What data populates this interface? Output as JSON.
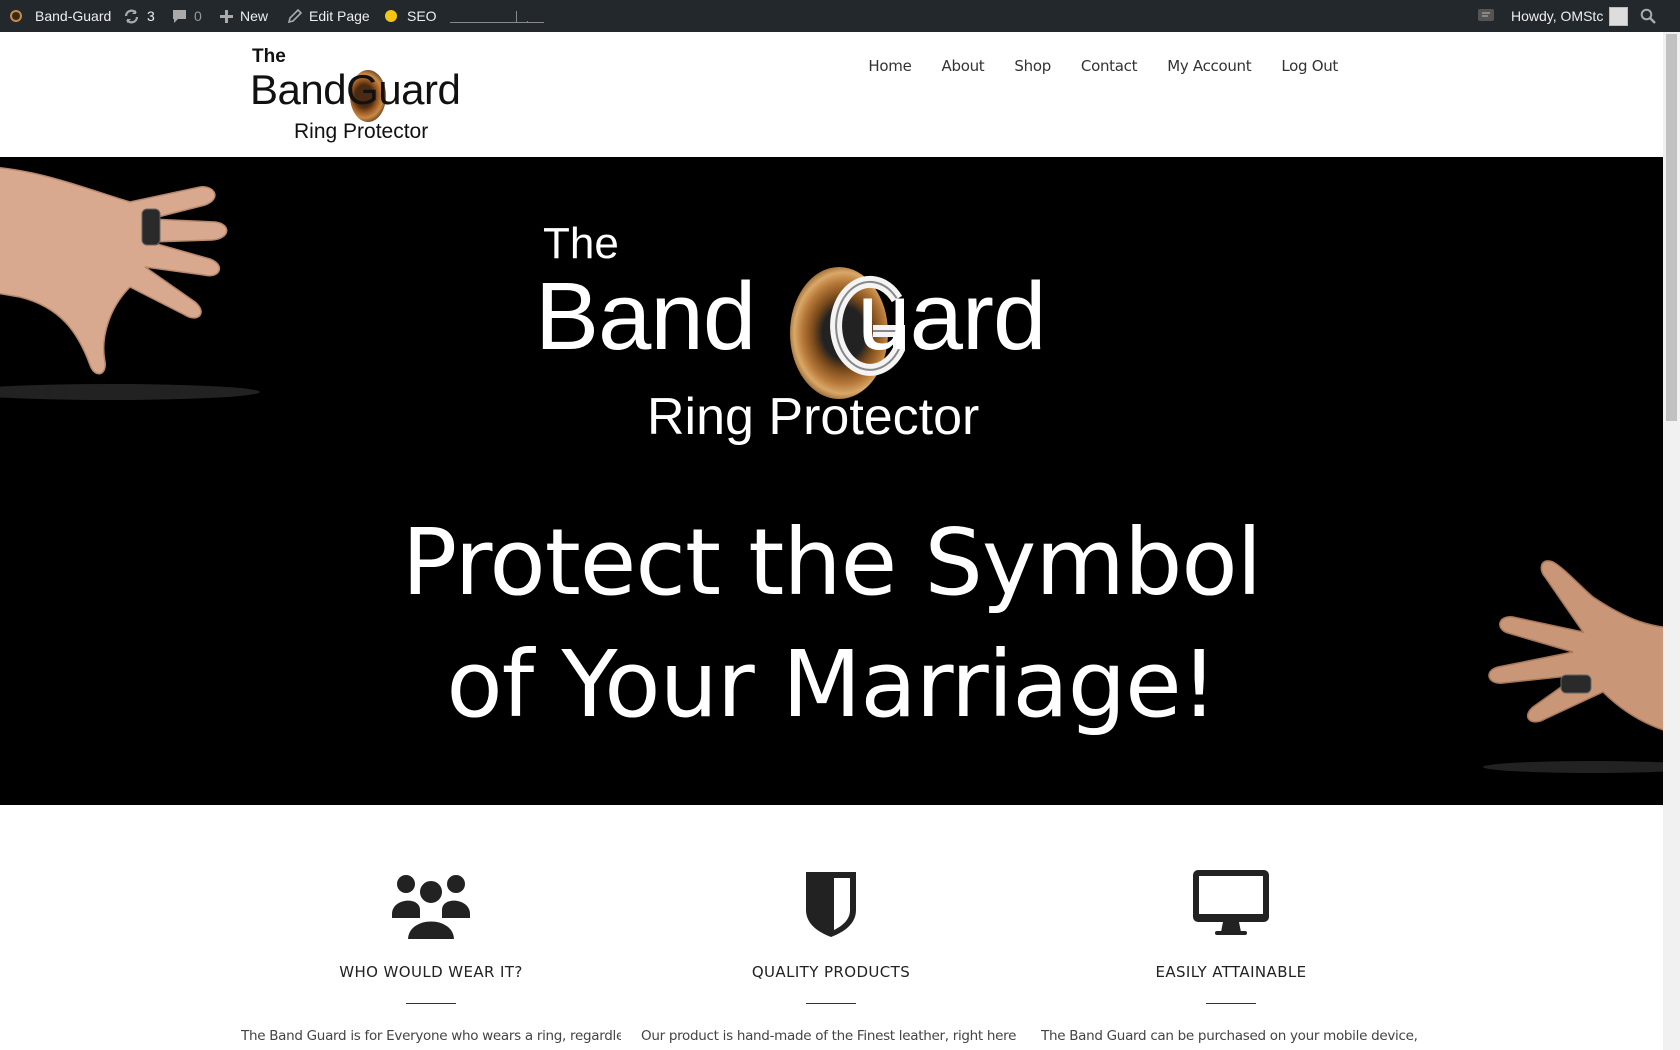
{
  "admin_bar": {
    "site_name": "Band-Guard",
    "updates_count": "3",
    "comments_count": "0",
    "new_label": "New",
    "edit_label": "Edit Page",
    "seo_label": "SEO",
    "howdy_label": "Howdy, OMStc",
    "icons": [
      "wp-logo-icon",
      "refresh-icon",
      "comment-icon",
      "plus-icon",
      "pencil-icon",
      "seo-status-dot",
      "notification-icon",
      "avatar",
      "search-icon"
    ]
  },
  "header": {
    "logo": {
      "the": "The",
      "brand_before": "Band",
      "brand_after": "Guard",
      "subtitle": "Ring Protector"
    },
    "nav": [
      "Home",
      "About",
      "Shop",
      "Contact",
      "My Account",
      "Log Out"
    ]
  },
  "hero": {
    "logo_the": "The",
    "logo_brand_before": "Band",
    "logo_brand_after": "uard",
    "logo_subtitle": "Ring Protector",
    "tagline_line1": "Protect the Symbol",
    "tagline_line2": "of Your Marriage!",
    "background_color": "#000000"
  },
  "features": [
    {
      "icon": "users-icon",
      "title": "WHO WOULD WEAR IT?",
      "text": "The Band Guard is for Everyone who wears a ring, regardless of"
    },
    {
      "icon": "shield-icon",
      "title": "QUALITY PRODUCTS",
      "text": "Our product is hand-made of the Finest leather, right here in"
    },
    {
      "icon": "desktop-icon",
      "title": "EASILY ATTAINABLE",
      "text": "The Band Guard can be purchased on your mobile device, tablet,"
    }
  ]
}
